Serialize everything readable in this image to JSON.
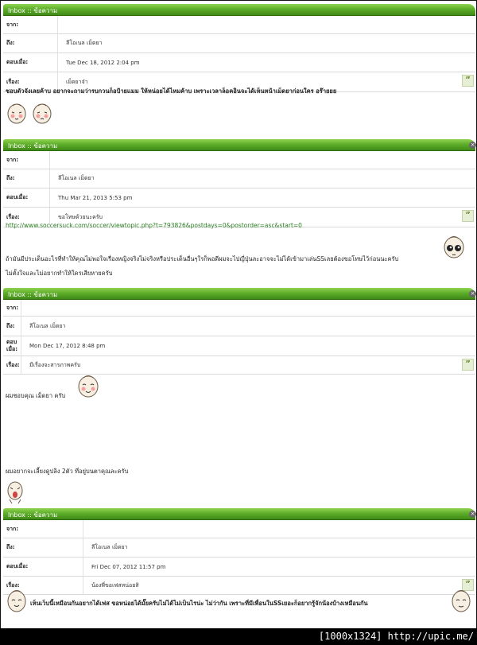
{
  "messages": [
    {
      "header_title": "Inbox :: ข้อความ",
      "labels": {
        "from": "จาก:",
        "to": "ถึง:",
        "date": "ตอบเมื่อ:",
        "subject": "เรื่อง:"
      },
      "from": "",
      "to": "ลีโอเนล เม็ดยา",
      "date": "Tue Dec 18, 2012 2:04 pm",
      "subject": "เม็ดยาจ๋า",
      "body_line1": "ชอบตัวจังเลยค้าบ อยากจะถามว่ารบกวนก็อป้ายแมม ให้หน่อยได้ไหมค้าบ เพราะเวลาล็อคอินจะได้เห็นหน้าเม็ดยาก่อนใคร อร๊ายยย"
    },
    {
      "header_title": "Inbox :: ข้อความ",
      "labels": {
        "from": "จาก:",
        "to": "ถึง:",
        "date": "ตอบเมื่อ:",
        "subject": "เรื่อง:"
      },
      "from": "",
      "to": "ลีโอเนล เม็ดยา",
      "date": "Thu Mar 21, 2013 5:53 pm",
      "subject": "ขอโทษด้วยนะครับ",
      "link": "http://www.soccersuck.com/soccer/viewtopic.php?t=793826&postdays=0&postorder=asc&start=0",
      "body_line1": "ถ้ามันมีประเด็นอะไรที่ทำให้คุณไม่พอใจเรื่องหญิงจริงไม่จริงหรือประเด็นอื่นๆใรก็พอดีผมจะไปญี่ปุ่นละอาจจะไม่ได้เข้ามาเล่นSSเลยต้องขอโทษไว้ก่อนนะครับ",
      "body_line2": "ไม่ตั้งใจและไม่อยากทำให้ใครเสียหายครับ"
    },
    {
      "header_title": "Inbox :: ข้อความ",
      "labels": {
        "from": "จาก:",
        "to": "ถึง:",
        "date": "ตอบ\nเมื่อ:",
        "subject": "เรื่อง:"
      },
      "from": "",
      "to": "ลีโอเนล เม็ดยา",
      "date": "Mon Dec 17, 2012 8:48 pm",
      "subject": "มีเรื่องจะสารภาพครับ",
      "body_line1": "ผมชอบคุณ เม็ดยา ครับ",
      "body_line2": "ผมอยากจะเลี้ยงดูปลิง 2ตัว ที่อยู่บนตาคุณละครับ"
    },
    {
      "header_title": "Inbox :: ข้อความ",
      "labels": {
        "from": "จาก:",
        "to": "ถึง:",
        "date": "ตอบเมื่อ:",
        "subject": "เรื่อง:"
      },
      "from": "",
      "to": "ลีโอเนล เม็ดยา",
      "date": "Fri Dec 07, 2012 11:57 pm",
      "subject": "น้องพี่ขอเฟสหน่อยสิ",
      "body_line1": "เห็นเว็บนี้เหมือนกันอยากได้เฟส ขอหน่อยได้มั๊ยครับไม่ได้ไม่เป็นไรน่ะ ไม่ว่ากัน เพราะที่มีเพื่อนในSSเยอะก็อยากรู้จักน้องบ้างเหมือนกัน"
    }
  ],
  "quote_glyph": "”",
  "close_glyph": "×",
  "footer_badge": "[1000x1324] http://upic.me/"
}
